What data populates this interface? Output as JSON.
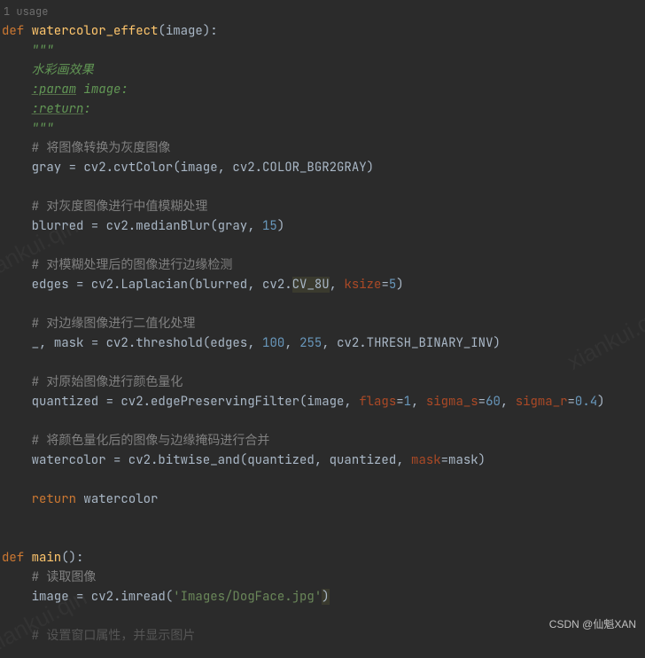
{
  "usage": "1 usage",
  "code": {
    "l1_def": "def",
    "l1_fn": "watercolor_effect",
    "l1_param": "image",
    "l2_doc": "\"\"\"",
    "l3_doc": "水彩画效果",
    "l4_tag": ":param",
    "l4_rest": " image:",
    "l5_tag": ":return",
    "l5_rest": ":",
    "l6_doc": "\"\"\"",
    "l7_comment": "# 将图像转换为灰度图像",
    "l8_a": "gray = cv2.cvtColor(image",
    "l8_b": ", ",
    "l8_c": "cv2.COLOR_BGR2GRAY)",
    "l10_comment": "# 对灰度图像进行中值模糊处理",
    "l11_a": "blurred = cv2.medianBlur(gray",
    "l11_c": "15",
    "l11_d": ")",
    "l13_comment": "# 对模糊处理后的图像进行边缘检测",
    "l14_a": "edges = cv2.Laplacian(blurred",
    "l14_b": "cv2.",
    "l14_c": "CV_8U",
    "l14_kw1": "ksize",
    "l14_v1": "5",
    "l16_comment": "# 对边缘图像进行二值化处理",
    "l17_a": "_",
    "l17_b": "mask = cv2.threshold(edges",
    "l17_n1": "100",
    "l17_n2": "255",
    "l17_c": "cv2.THRESH_BINARY_INV)",
    "l19_comment": "# 对原始图像进行颜色量化",
    "l20_a": "quantized = cv2.edgePreservingFilter(image",
    "l20_kw1": "flags",
    "l20_v1": "1",
    "l20_kw2": "sigma_s",
    "l20_v2": "60",
    "l20_kw3": "sigma_r",
    "l20_v3": "0.4",
    "l22_comment": "# 将颜色量化后的图像与边缘掩码进行合并",
    "l23_a": "watercolor = cv2.bitwise_and(quantized",
    "l23_b": "quantized",
    "l23_kw": "mask",
    "l23_c": "=mask)",
    "l25_ret": "return",
    "l25_val": "watercolor",
    "l28_def": "def",
    "l28_fn": "main",
    "l29_comment": "# 读取图像",
    "l30_a": "image = cv2.imread(",
    "l30_str": "'Images/DogFace.jpg'",
    "l30_c": ")",
    "l32_comment": "# 设置窗口属性，并显示图片"
  },
  "watermark": "xiankui.qin",
  "attribution": "CSDN @仙魁XAN"
}
